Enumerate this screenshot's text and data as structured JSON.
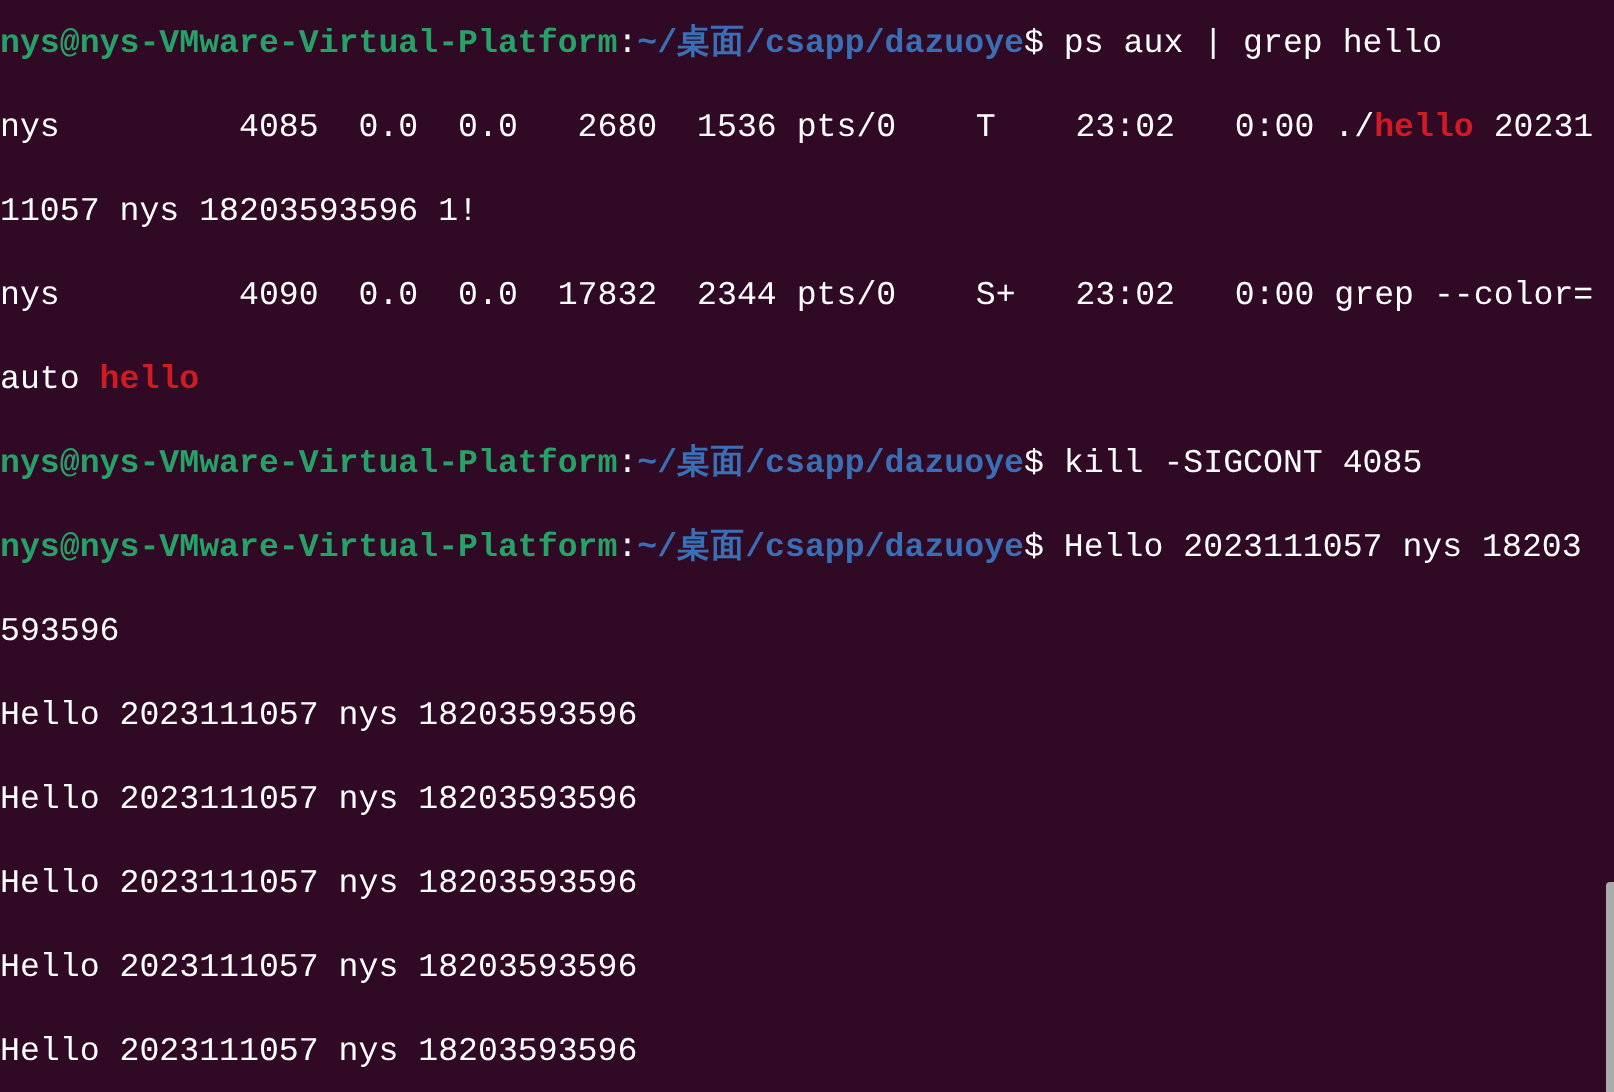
{
  "terminal": {
    "lines": [
      [
        {
          "kind": "host",
          "text": "nys@nys-VMware-Virtual-Platform"
        },
        {
          "kind": "sep",
          "text": ":"
        },
        {
          "kind": "path",
          "text": "~/桌面/csapp/dazuoye"
        },
        {
          "kind": "text",
          "text": "$ ps aux | grep hello"
        }
      ],
      [
        {
          "kind": "text",
          "text": "nys         4085  0.0  0.0   2680  1536 pts/0    T    23:02   0:00 ./"
        },
        {
          "kind": "match",
          "text": "hello"
        },
        {
          "kind": "text",
          "text": " 20231"
        }
      ],
      [
        {
          "kind": "text",
          "text": "11057 nys 18203593596 1!"
        }
      ],
      [
        {
          "kind": "text",
          "text": "nys         4090  0.0  0.0  17832  2344 pts/0    S+   23:02   0:00 grep --color="
        }
      ],
      [
        {
          "kind": "text",
          "text": "auto "
        },
        {
          "kind": "match",
          "text": "hello"
        }
      ],
      [
        {
          "kind": "host",
          "text": "nys@nys-VMware-Virtual-Platform"
        },
        {
          "kind": "sep",
          "text": ":"
        },
        {
          "kind": "path",
          "text": "~/桌面/csapp/dazuoye"
        },
        {
          "kind": "text",
          "text": "$ kill -SIGCONT 4085"
        }
      ],
      [
        {
          "kind": "host",
          "text": "nys@nys-VMware-Virtual-Platform"
        },
        {
          "kind": "sep",
          "text": ":"
        },
        {
          "kind": "path",
          "text": "~/桌面/csapp/dazuoye"
        },
        {
          "kind": "text",
          "text": "$ Hello 2023111057 nys 18203"
        }
      ],
      [
        {
          "kind": "text",
          "text": "593596"
        }
      ],
      [
        {
          "kind": "text",
          "text": "Hello 2023111057 nys 18203593596"
        }
      ],
      [
        {
          "kind": "text",
          "text": "Hello 2023111057 nys 18203593596"
        }
      ],
      [
        {
          "kind": "text",
          "text": "Hello 2023111057 nys 18203593596"
        }
      ],
      [
        {
          "kind": "text",
          "text": "Hello 2023111057 nys 18203593596"
        }
      ],
      [
        {
          "kind": "text",
          "text": "Hello 2023111057 nys 18203593596"
        }
      ]
    ]
  }
}
